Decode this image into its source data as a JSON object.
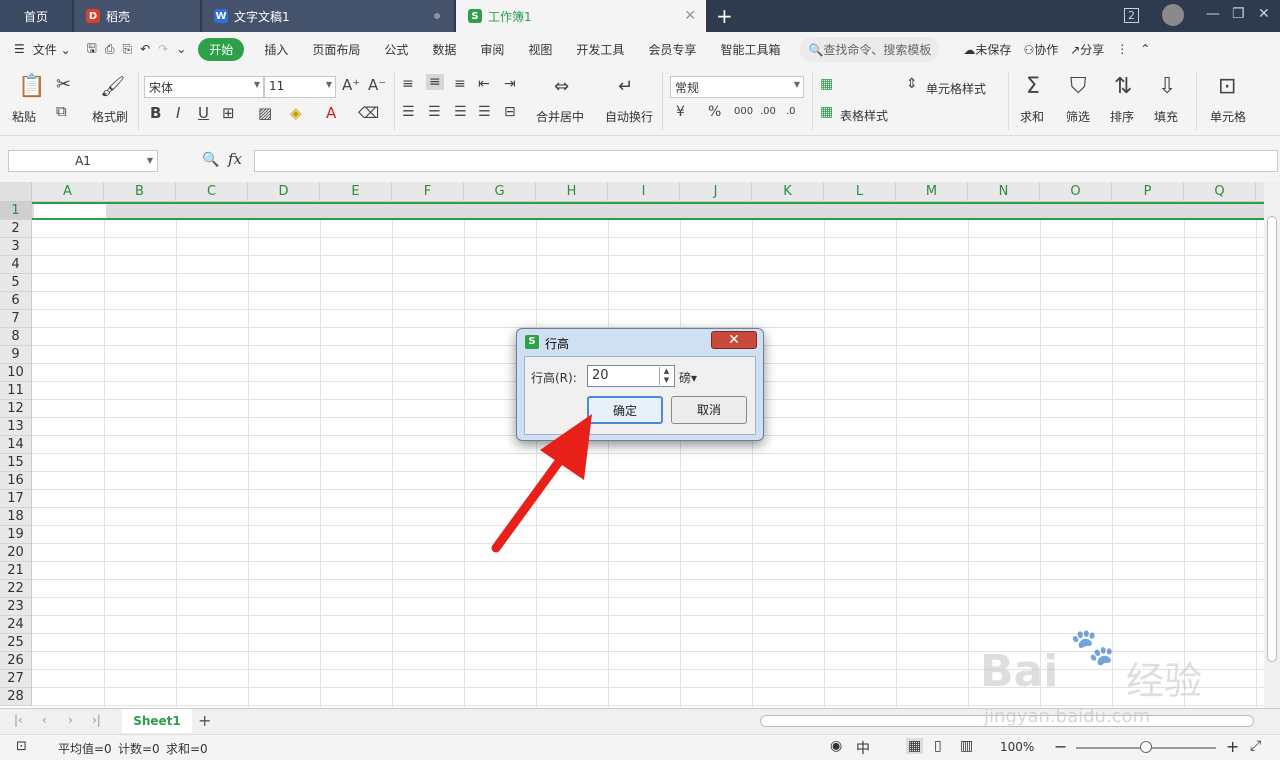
{
  "tabs": {
    "home": "首页",
    "daoke": "稻壳",
    "doc": "文字文稿1",
    "book": "工作簿1",
    "page_count": "2"
  },
  "menu": {
    "file": "文件",
    "items": [
      "开始",
      "插入",
      "页面布局",
      "公式",
      "数据",
      "审阅",
      "视图",
      "开发工具",
      "会员专享",
      "智能工具箱"
    ],
    "search": "查找命令、搜索模板",
    "unsaved": "未保存",
    "collab": "协作",
    "share": "分享"
  },
  "ribbon": {
    "paste": "粘贴",
    "format_painter": "格式刷",
    "font_name": "宋体",
    "font_size": "11",
    "merge_center": "合并居中",
    "wrap_text": "自动换行",
    "number_format": "常规",
    "cell_style": "单元格样式",
    "table_style": "表格样式",
    "sum": "求和",
    "filter": "筛选",
    "sort": "排序",
    "fill": "填充",
    "cell": "单元格"
  },
  "formula": {
    "cell_ref": "A1",
    "fx": "fx"
  },
  "grid": {
    "columns": [
      "A",
      "B",
      "C",
      "D",
      "E",
      "F",
      "G",
      "H",
      "I",
      "J",
      "K",
      "L",
      "M",
      "N",
      "O",
      "P",
      "Q"
    ],
    "rows": [
      "1",
      "2",
      "3",
      "4",
      "5",
      "6",
      "7",
      "8",
      "9",
      "10",
      "11",
      "12",
      "13",
      "14",
      "15",
      "16",
      "17",
      "18",
      "19",
      "20",
      "21",
      "22",
      "23",
      "24",
      "25",
      "26",
      "27",
      "28"
    ]
  },
  "sheet": {
    "name": "Sheet1"
  },
  "status": {
    "avg": "平均值=0",
    "count": "计数=0",
    "sum": "求和=0",
    "zoom": "100%"
  },
  "dialog": {
    "title": "行高",
    "label": "行高(R):",
    "value": "20",
    "unit": "磅",
    "ok": "确定",
    "cancel": "取消"
  },
  "watermark": {
    "site": "jingyan.baidu.com",
    "brand": "Bai",
    "suffix": "经验"
  },
  "colors": {
    "accent": "#2ea049",
    "titlebar": "#2e3b4e",
    "arrow": "#e8201a"
  }
}
